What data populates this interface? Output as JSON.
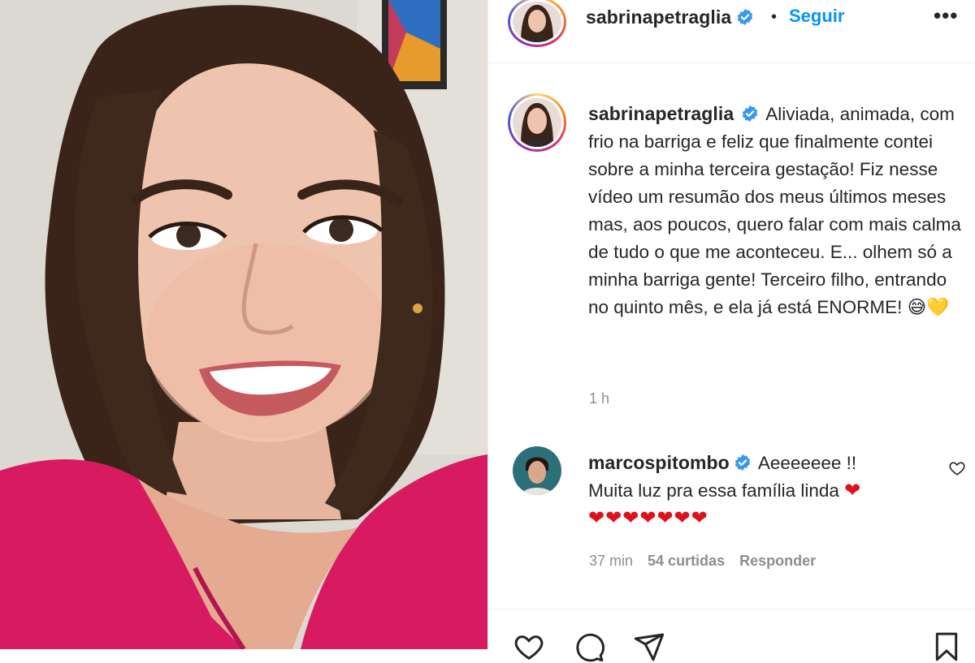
{
  "post": {
    "author": "sabrinapetraglia",
    "follow_label": "Seguir",
    "separator": "•",
    "more_label": "•••",
    "caption_text": "Aliviada, animada, com frio na barriga e feliz que finalmente contei sobre a minha terceira gestação! Fiz nesse vídeo um resumão dos meus últimos meses mas, aos poucos, quero falar com mais calma de tudo o que me aconteceu. E... olhem só a minha barriga gente! Terceiro filho, entrando no quinto mês, e ela já está ENORME!",
    "caption_emojis": "😅💛",
    "time": "1 h"
  },
  "comment": {
    "author": "marcospitombo",
    "line1": "Aeeeeeee !!",
    "line2": "Muita luz pra essa família linda",
    "hearts_inline": "❤",
    "hearts_row": "❤❤❤❤❤❤❤",
    "time": "37 min",
    "likes": "54 curtidas",
    "reply": "Responder"
  },
  "colors": {
    "link_blue": "#0095f6",
    "verified_blue": "#3897f0",
    "muted": "#8e8e8e",
    "shirt": "#d81b60"
  },
  "icons": [
    "verified-badge-icon",
    "heart-outline-icon",
    "comment-icon",
    "share-icon",
    "save-icon",
    "more-icon"
  ]
}
